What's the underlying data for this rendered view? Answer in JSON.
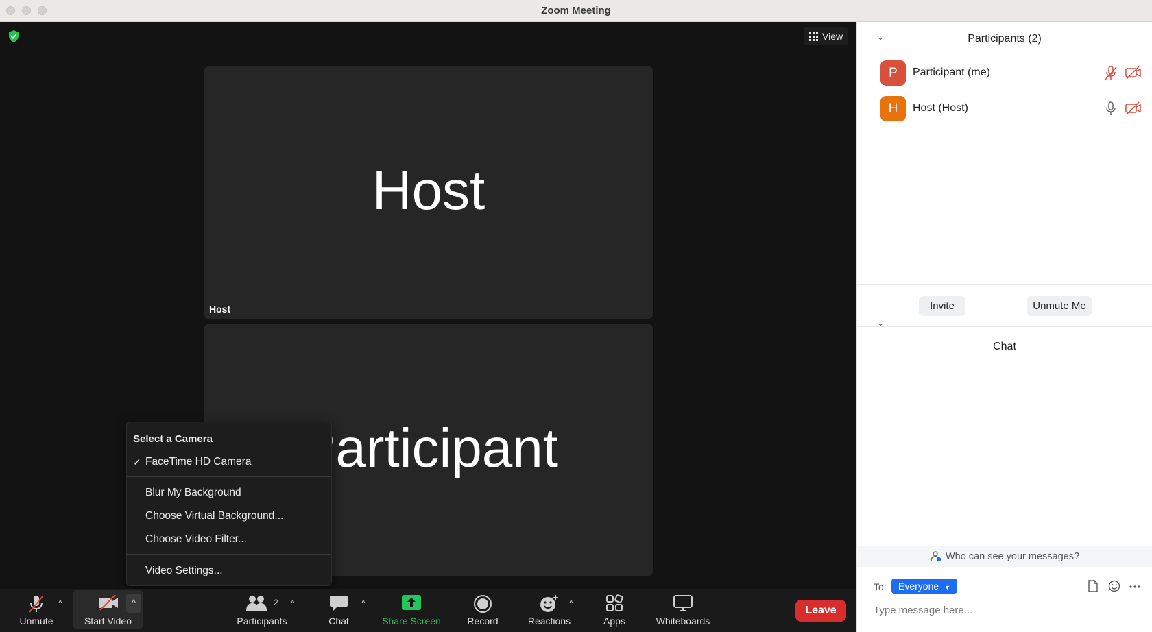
{
  "window": {
    "title": "Zoom Meeting"
  },
  "stage": {
    "view_label": "View",
    "tiles": [
      {
        "big_name": "Host",
        "label": "Host"
      },
      {
        "big_name": "Participant",
        "label": ""
      }
    ]
  },
  "camera_menu": {
    "heading": "Select a Camera",
    "camera": "FaceTime HD Camera",
    "check": "✓",
    "blur": "Blur My Background",
    "virtual_bg": "Choose Virtual Background...",
    "video_filter": "Choose Video Filter...",
    "settings": "Video Settings..."
  },
  "toolbar": {
    "unmute": "Unmute",
    "start_video": "Start Video",
    "participants": "Participants",
    "participants_count": "2",
    "chat": "Chat",
    "share_screen": "Share Screen",
    "record": "Record",
    "reactions": "Reactions",
    "apps": "Apps",
    "whiteboards": "Whiteboards",
    "leave": "Leave",
    "caret": "^"
  },
  "participants_panel": {
    "title": "Participants (2)",
    "people": [
      {
        "initial": "P",
        "name": "Participant (me)",
        "avatar_color": "#d9513c",
        "mic": "muted",
        "video": "off"
      },
      {
        "initial": "H",
        "name": "Host (Host)",
        "avatar_color": "#e8730c",
        "mic": "on",
        "video": "off"
      }
    ],
    "invite": "Invite",
    "unmute_me": "Unmute Me"
  },
  "chat_panel": {
    "title": "Chat",
    "who_can_see": "Who can see your messages?",
    "to_label": "To:",
    "recipient": "Everyone",
    "placeholder": "Type message here..."
  },
  "colors": {
    "accent_blue": "#1d6df2",
    "share_green": "#22c55e",
    "leave_red": "#d92c2c",
    "muted_red": "#e0463a"
  }
}
